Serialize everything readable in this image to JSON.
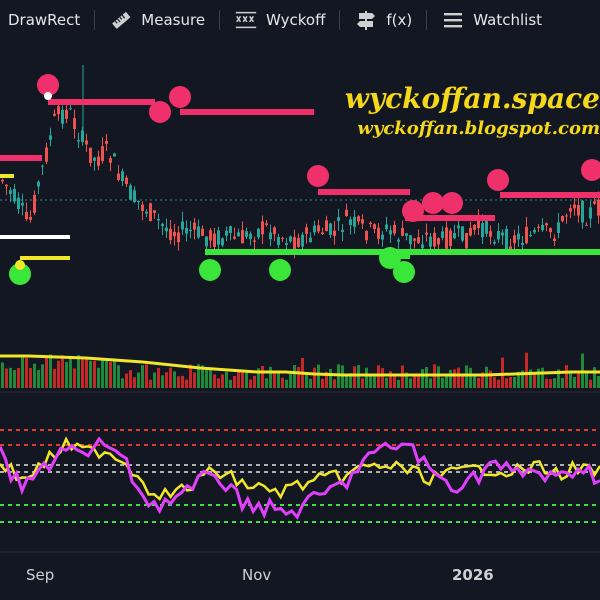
{
  "toolbar": {
    "items": [
      {
        "label": "DrawRect",
        "icon": "draw-rect-icon"
      },
      {
        "label": "Measure",
        "icon": "ruler-icon"
      },
      {
        "label": "Wyckoff",
        "icon": "wyckoff-pattern-icon"
      },
      {
        "label": "f(x)",
        "icon": "signpost-icon"
      },
      {
        "label": "Watchlist",
        "icon": "list-icon"
      }
    ]
  },
  "watermark": {
    "line1": "wyckoffan.space",
    "line2": "wyckoffan.blogspot.com"
  },
  "colors": {
    "background": "#131722",
    "up_candle": "#26a69a",
    "down_candle": "#ef5350",
    "resistance": "#f0306a",
    "support": "#39e639",
    "watermark": "#f5d81a",
    "volume_ma": "#f0e62a",
    "osc_fast": "#e040fb",
    "osc_slow": "#f0e62a"
  },
  "chart_data": {
    "type": "candlestick",
    "x_ticks": [
      {
        "label": "Sep",
        "bold": false
      },
      {
        "label": "Nov",
        "bold": false
      },
      {
        "label": "2026",
        "bold": true
      }
    ],
    "resistance_levels": [
      [
        0,
        42,
        158
      ],
      [
        48,
        155,
        102
      ],
      [
        180,
        314,
        112
      ],
      [
        318,
        410,
        192
      ],
      [
        405,
        495,
        218
      ],
      [
        500,
        600,
        195
      ]
    ],
    "support_levels": [
      [
        0,
        70,
        237
      ],
      [
        20,
        70,
        258
      ],
      [
        205,
        600,
        252
      ]
    ],
    "supply_markers": [
      48,
      85,
      160,
      112,
      180,
      97,
      318,
      176,
      413,
      211,
      433,
      203,
      452,
      203,
      498,
      180,
      592,
      170
    ],
    "demand_markers": [
      20,
      274,
      210,
      270,
      280,
      270,
      390,
      258,
      404,
      272
    ],
    "price_series": [
      180,
      200,
      225,
      170,
      118,
      110,
      140,
      160,
      150,
      180,
      200,
      210,
      225,
      232,
      230,
      235,
      238,
      236,
      239,
      232,
      228,
      236,
      240,
      237,
      230,
      233,
      220,
      228,
      233,
      230,
      236,
      240,
      237,
      242,
      235,
      238,
      226,
      232,
      240,
      238,
      236,
      233,
      230,
      200,
      215,
      208
    ],
    "volume_ma": [
      356,
      356,
      357,
      358,
      360,
      362,
      365,
      368,
      370,
      372,
      372,
      374,
      375,
      375,
      375,
      375,
      375,
      375,
      374,
      373,
      372,
      372
    ],
    "oscillator_fast": [
      455,
      490,
      470,
      445,
      458,
      440,
      470,
      505,
      500,
      490,
      470,
      498,
      505,
      512,
      510,
      495,
      485,
      460,
      450,
      442,
      470,
      485,
      480,
      462,
      475,
      470,
      482,
      465,
      478
    ],
    "oscillator_slow": [
      460,
      480,
      465,
      445,
      452,
      450,
      465,
      490,
      495,
      485,
      470,
      480,
      488,
      492,
      485,
      480,
      476,
      468,
      465,
      470,
      478,
      474,
      470,
      468,
      472,
      466,
      474,
      468,
      472
    ],
    "osc_levels": [
      430,
      445,
      465,
      472,
      505,
      522
    ]
  }
}
